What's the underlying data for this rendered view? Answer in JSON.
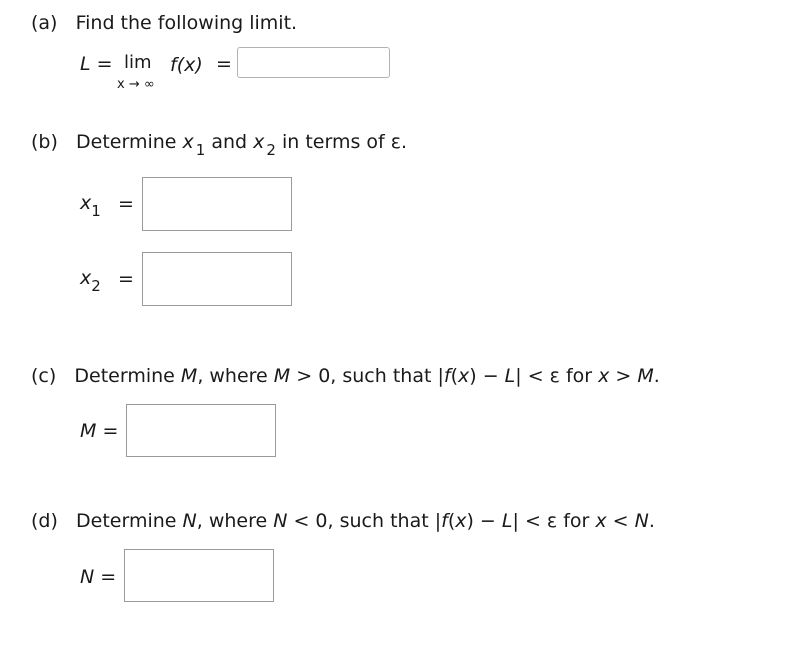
{
  "parts": {
    "a": {
      "label": "(a)",
      "prompt": "Find the following limit.",
      "lhs": "L",
      "eq1": "=",
      "lim": "lim",
      "lim_sub": "x → ∞",
      "func": "f(x)",
      "eq2": "=",
      "answer": ""
    },
    "b": {
      "label": "(b)",
      "prompt_1": "Determine ",
      "x": "x",
      "sub1": "1",
      "prompt_2": " and ",
      "sub2": "2",
      "prompt_3": " in terms of ",
      "epsilon": "ε",
      "prompt_end": ".",
      "x1_label": "x",
      "x1_sub": "1",
      "x2_label": "x",
      "x2_sub": "2",
      "eq": "=",
      "x1_answer": "",
      "x2_answer": ""
    },
    "c": {
      "label": "(c)",
      "t1": "Determine ",
      "M": "M",
      "t2": ", where ",
      "t3": " > 0, such that |",
      "f": "f",
      "t4": "(",
      "x": "x",
      "t5": ") − ",
      "L": "L",
      "t6": "| < ε for ",
      "t7": " > ",
      "t8": ".",
      "answer_label": "M",
      "eq": "=",
      "answer": ""
    },
    "d": {
      "label": "(d)",
      "t1": "Determine ",
      "N": "N",
      "t2": ", where ",
      "t3": " < 0, such that |",
      "f": "f",
      "t4": "(",
      "x": "x",
      "t5": ") − ",
      "L": "L",
      "t6": "| < ε for ",
      "t7": " < ",
      "t8": ".",
      "answer_label": "N",
      "eq": "=",
      "answer": ""
    }
  }
}
